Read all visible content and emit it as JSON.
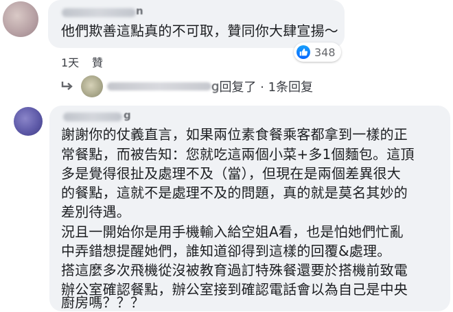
{
  "comment1": {
    "author_visible_tail": "n",
    "text": "他們欺善這點真的不可取，贊同你大肆宣揚～",
    "time": "1天",
    "like_label": "贊",
    "reaction_count": "348"
  },
  "reply_summary": {
    "name_tail": "g",
    "label": "回复了 · 1条回复"
  },
  "comment2": {
    "author_visible_tail": "g",
    "lines": [
      "謝謝你的仗義直言，如果兩位素食餐乘客都拿到一樣的正",
      "常餐點，而被告知：您就吃這兩個小菜+多1個麵包。這頂",
      "多是覺得很扯及處理不及（當），但現在是兩個差異很大",
      "的餐點，這就不是處理不及的問題，真的就是莫名其妙的",
      "差別待遇。",
      "況且一開始你是用手機輸入給空姐A看，也是怕她們忙亂",
      "中弄錯想提醒她們，誰知道卻得到這樣的回覆&處理。",
      "搭這麼多次飛機從沒被教育過訂特殊餐還要於搭機前致電",
      "辦公室確認餐點，辦公室接到確認電話會以為自己是中央",
      "廚房嗎？？？"
    ]
  },
  "icons": {
    "reaction": "thumbs-up-icon",
    "reply": "reply-arrow-icon"
  },
  "colors": {
    "bubble": "#f0f2f5",
    "like_blue": "#0866ff"
  }
}
